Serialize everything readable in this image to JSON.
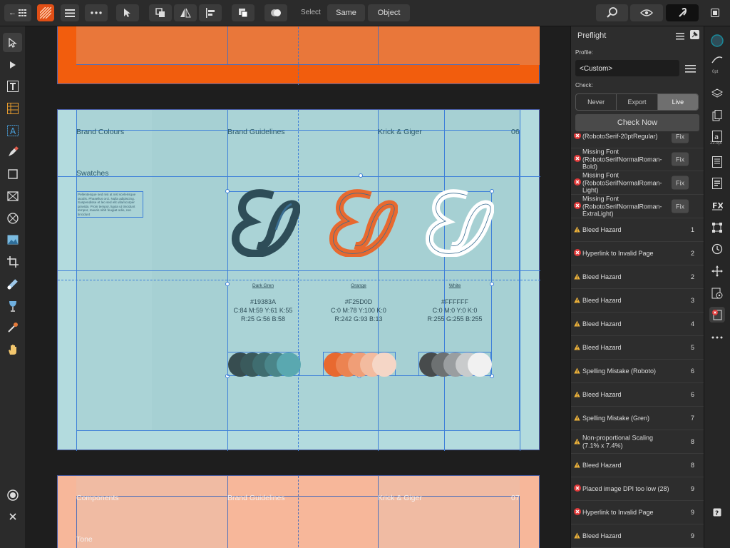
{
  "toolbar": {
    "back_label": "←",
    "select_label": "Select",
    "same_label": "Same",
    "object_label": "Object"
  },
  "preflight": {
    "title": "Preflight",
    "profile_label": "Profile:",
    "profile_value": "<Custom>",
    "check_label": "Check:",
    "modes": [
      "Never",
      "Export",
      "Live"
    ],
    "active_mode": "Live",
    "check_now": "Check Now",
    "fix_label": "Fix",
    "items": [
      {
        "type": "error",
        "text": "(RobotoSerif-20ptRegular)",
        "fix": true,
        "page": ""
      },
      {
        "type": "error",
        "text": "Missing Font (RobotoSerifNormalRoman-Bold)",
        "fix": true,
        "page": ""
      },
      {
        "type": "error",
        "text": "Missing Font (RobotoSerifNormalRoman-Light)",
        "fix": true,
        "page": ""
      },
      {
        "type": "error",
        "text": "Missing Font (RobotoSerifNormalRoman-ExtraLight)",
        "fix": true,
        "page": ""
      },
      {
        "type": "warning",
        "text": "Bleed Hazard",
        "fix": false,
        "page": "1"
      },
      {
        "type": "error",
        "text": "Hyperlink to Invalid Page",
        "fix": false,
        "page": "2"
      },
      {
        "type": "warning",
        "text": "Bleed Hazard",
        "fix": false,
        "page": "2"
      },
      {
        "type": "warning",
        "text": "Bleed Hazard",
        "fix": false,
        "page": "3"
      },
      {
        "type": "warning",
        "text": "Bleed Hazard",
        "fix": false,
        "page": "4"
      },
      {
        "type": "warning",
        "text": "Bleed Hazard",
        "fix": false,
        "page": "5"
      },
      {
        "type": "warning",
        "text": "Spelling Mistake (Roboto)",
        "fix": false,
        "page": "6"
      },
      {
        "type": "warning",
        "text": "Bleed Hazard",
        "fix": false,
        "page": "6"
      },
      {
        "type": "warning",
        "text": "Spelling Mistake (Gren)",
        "fix": false,
        "page": "7"
      },
      {
        "type": "warning",
        "text": "Non-proportional Scaling (7.1% x 7.4%)",
        "fix": false,
        "page": "8"
      },
      {
        "type": "warning",
        "text": "Bleed Hazard",
        "fix": false,
        "page": "8"
      },
      {
        "type": "error",
        "text": "Placed image DPI too low (28)",
        "fix": false,
        "page": "9"
      },
      {
        "type": "error",
        "text": "Hyperlink to Invalid Page",
        "fix": false,
        "page": "9"
      },
      {
        "type": "warning",
        "text": "Bleed Hazard",
        "fix": false,
        "page": "9"
      }
    ]
  },
  "right_strip": {
    "stroke_width": "0pt",
    "font_size": "22.9pt"
  },
  "document": {
    "page6": {
      "section": "Brand Colours",
      "header_center": "Brand Guidelines",
      "header_right": "Krick & Giger",
      "page_number": "06",
      "swatches_title": "Swatches",
      "body_text": "Pellentesque sed nisi at nisl scelerisque iaculis. Phasellus orci. Nulla adipiscing. Suspendisse et leo sed elit ullamcorper gravida. Proin tempor, ligula ut tincidunt tempor, mauris nibh feugiat odio, nec tincidunt",
      "swatches": [
        {
          "name": "Dark Gren",
          "hex": "#19383A",
          "cmyk": "C:84 M:59 Y:61 K:55",
          "rgb": "R:25 G:56 B:58",
          "color": "#2e4d58",
          "accent": "#3a6e92",
          "tints": [
            "#374d50",
            "#3a5a5c",
            "#3f6d70",
            "#4a8589",
            "#5aa8b0"
          ]
        },
        {
          "name": "Orange",
          "hex": "#F25D0D",
          "cmyk": "C:0 M:78 Y:100 K:0",
          "rgb": "R:242 G:93 B:13",
          "color": "#e8692f",
          "accent": "#3a6e92",
          "tints": [
            "#e8692f",
            "#ec8351",
            "#f09e77",
            "#f3bb9f",
            "#f5d6c6"
          ]
        },
        {
          "name": "White",
          "hex": "#FFFFFF",
          "cmyk": "C:0 M:0 Y:0 K:0",
          "rgb": "R:255 G:255 B:255",
          "color": "#ffffff",
          "accent": "#3a6e92",
          "tints": [
            "#474b4c",
            "#6d7172",
            "#9a9ea0",
            "#c9cbcc",
            "#f1f1f1"
          ]
        }
      ]
    },
    "page7": {
      "section": "Components",
      "header_center": "Brand Guidelines",
      "header_right": "Krick & Giger",
      "page_number": "07",
      "subtitle": "Tone"
    }
  },
  "colors": {
    "page5_bg": "#f25d0d",
    "page6_bg": "#b3dbde",
    "page7_bg": "#f7b79a",
    "guide": "#3d7fd9"
  }
}
